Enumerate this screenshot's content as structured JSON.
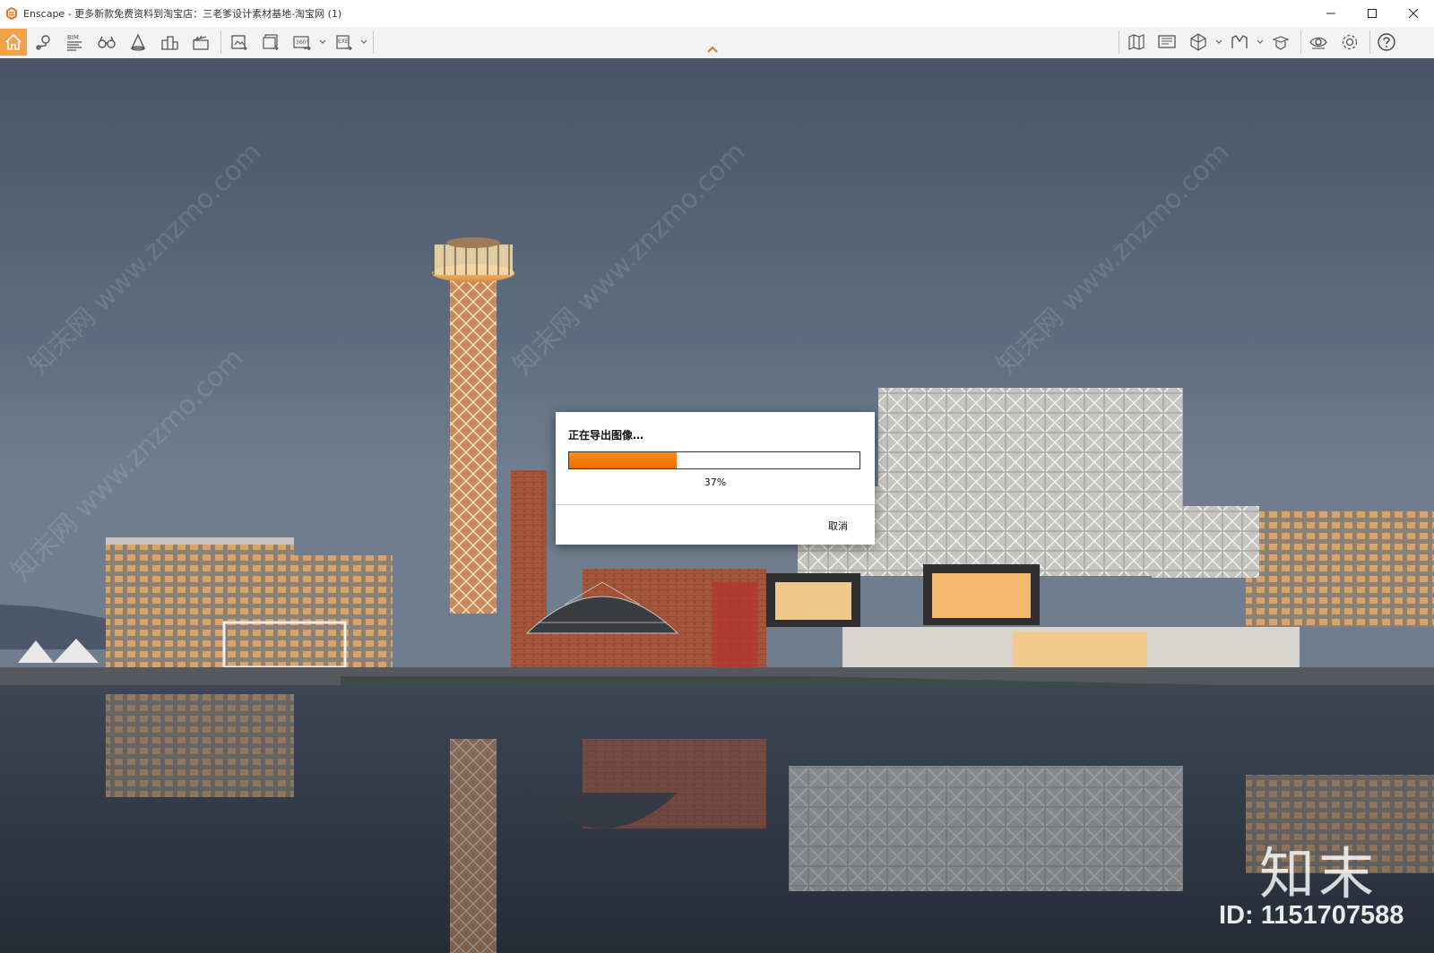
{
  "window": {
    "title": "Enscape - 更多新款免费资料到淘宝店：三老爹设计素材基地-淘宝网 (1)",
    "app_icon": "enscape-logo-icon",
    "controls": [
      "minimize-icon",
      "maximize-icon",
      "close-icon"
    ]
  },
  "toolbar": {
    "left_tools": [
      {
        "name": "home-icon",
        "active": true
      },
      {
        "name": "location-pin-icon"
      },
      {
        "name": "bim-icon",
        "label": "BIM"
      },
      {
        "name": "binoculars-icon"
      },
      {
        "name": "cone-asset-icon"
      },
      {
        "name": "buildings-icon"
      },
      {
        "name": "clapperboard-icon"
      },
      {
        "name": "screenshot-export-icon"
      },
      {
        "name": "batch-export-icon"
      },
      {
        "name": "panorama-360-icon",
        "label": "360°",
        "dropdown": true
      },
      {
        "name": "exe-export-icon",
        "label": "EXE",
        "dropdown": true
      }
    ],
    "right_tools": [
      {
        "name": "map-icon"
      },
      {
        "name": "monitor-icon"
      },
      {
        "name": "cube-view-icon",
        "dropdown": true
      },
      {
        "name": "vr-headset-icon",
        "dropdown": true
      },
      {
        "name": "collaborate-icon"
      },
      {
        "name": "eye-visual-settings-icon"
      },
      {
        "name": "gear-icon"
      },
      {
        "name": "help-icon"
      }
    ],
    "accent_color": "#f4a14a"
  },
  "dialog": {
    "title": "正在导出图像…",
    "progress": 0.37,
    "percent_text": "37%",
    "cancel_label": "取消",
    "progress_color": "#f57a00"
  },
  "watermark": {
    "diagonal_text": "知末网 www.znzmo.com",
    "brand_logo": "知末",
    "brand_id": "ID: 1151707588"
  }
}
